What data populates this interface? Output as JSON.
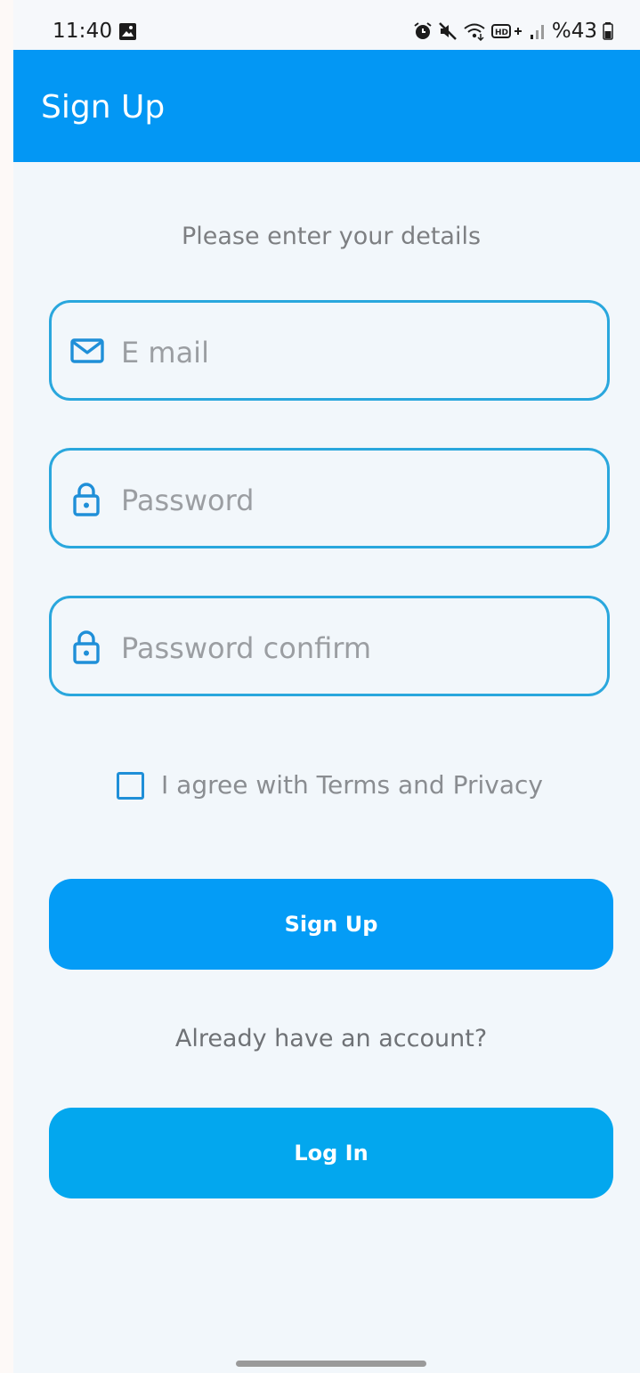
{
  "status_bar": {
    "time": "11:40",
    "battery_text": "%43",
    "icons": [
      "gallery-icon",
      "alarm-icon",
      "mute-icon",
      "wifi-icon",
      "hd-plus-icon",
      "signal-icon",
      "battery-icon"
    ]
  },
  "app_bar": {
    "title": "Sign Up"
  },
  "form": {
    "subtitle": "Please enter your details",
    "email_placeholder": "E mail",
    "password_placeholder": "Password",
    "password_confirm_placeholder": "Password confirm",
    "agree_label": "I agree with Terms and Privacy",
    "agree_checked": false
  },
  "buttons": {
    "signup_label": "Sign Up",
    "have_account_text": "Already have an account?",
    "login_label": "Log In"
  },
  "colors": {
    "primary": "#0397f4",
    "field_border": "#2aa7dd",
    "icon": "#1f8fd8",
    "background": "#f2f7fb"
  }
}
